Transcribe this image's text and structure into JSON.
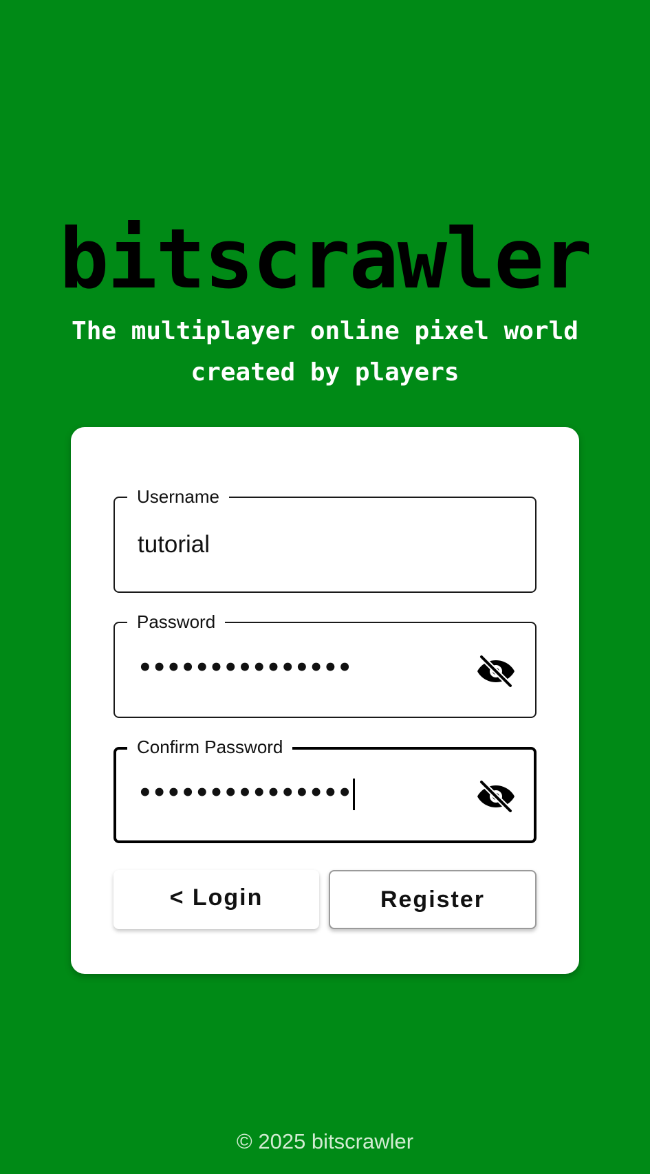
{
  "app": {
    "title": "bitscrawler",
    "tagline_line1": "The multiplayer online pixel world",
    "tagline_line2": "created by players"
  },
  "form": {
    "username": {
      "label": "Username",
      "value": "tutorial"
    },
    "password": {
      "label": "Password",
      "masked_value": "•••••••••••••••",
      "toggle_icon": "eye-off-icon"
    },
    "confirm_password": {
      "label": "Confirm Password",
      "masked_value": "•••••••••••••••",
      "toggle_icon": "eye-off-icon"
    }
  },
  "buttons": {
    "login_label": "< Login",
    "register_label": "Register"
  },
  "footer": {
    "text": "© 2025 bitscrawler"
  },
  "colors": {
    "background": "#008a16",
    "card": "#ffffff",
    "title": "#000000",
    "tagline": "#ffffff"
  }
}
